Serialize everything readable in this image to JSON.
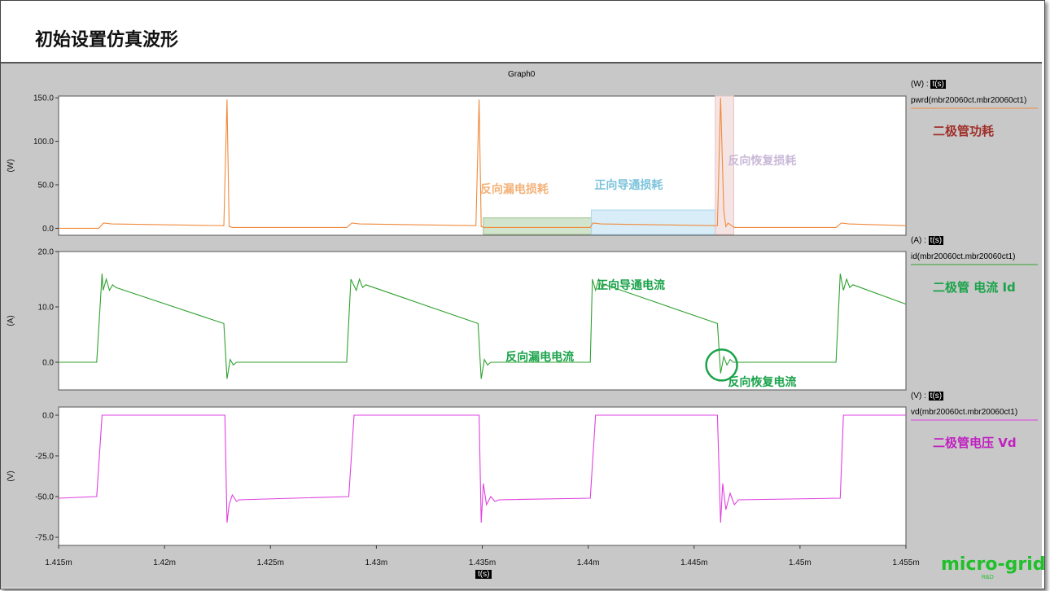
{
  "slide": {
    "title": "初始设置仿真波形"
  },
  "graph": {
    "name": "Graph0",
    "xlabel": "t(s)"
  },
  "chart_data": [
    {
      "type": "line",
      "ylabel": "(W)",
      "legend_unit": "(W) : t(s)",
      "legend_name": "pwrd(mbr20060ct.mbr20060ct1)",
      "series_title": "二极管功耗",
      "color": "#f08a3c",
      "title_color": "#a0302a",
      "xlim": [
        1.415,
        1.455
      ],
      "ylim": [
        -8,
        152
      ],
      "yticks": [
        150,
        100,
        50,
        0
      ],
      "ytick_labels": [
        "150.0",
        "100.0",
        "50.0",
        "0.0"
      ],
      "series": [
        {
          "x": [
            1.415,
            1.4169,
            1.41712,
            1.4175,
            1.4228,
            1.42295,
            1.42305,
            1.4232,
            1.4286,
            1.42885,
            1.4292,
            1.4347,
            1.43485,
            1.43495,
            1.4351,
            1.4401,
            1.44022,
            1.4406,
            1.4461,
            1.44625,
            1.4464,
            1.4465,
            1.4466,
            1.4469,
            1.4517,
            1.45195,
            1.4523,
            1.455
          ],
          "y": [
            0,
            0,
            6,
            5,
            3,
            148,
            2,
            1,
            1,
            6,
            5,
            3,
            148,
            2,
            1,
            1,
            6,
            5,
            3,
            150,
            20,
            2,
            6,
            1,
            1,
            6,
            5,
            3
          ]
        }
      ],
      "annotations": [
        {
          "text": "反向漏电损耗",
          "color": "#f3b27a",
          "x": 1.4349,
          "y": 45
        },
        {
          "text": "正向导通损耗",
          "color": "#7cc3dc",
          "x": 1.4403,
          "y": 50
        },
        {
          "text": "反向恢复损耗",
          "color": "#c9b9d8",
          "x": 1.4466,
          "y": 78
        }
      ],
      "regions": [
        {
          "x0": 1.43505,
          "x1": 1.44015,
          "y0": -7,
          "y1": 12,
          "color": "#9dc38f"
        },
        {
          "x0": 1.44015,
          "x1": 1.446,
          "y0": -7,
          "y1": 21,
          "color": "#a8d8ee"
        },
        {
          "x0": 1.446,
          "x1": 1.44687,
          "y0": -7,
          "y1": 152,
          "color": "#e8c4c4"
        }
      ]
    },
    {
      "type": "line",
      "ylabel": "(A)",
      "legend_unit": "(A) : t(s)",
      "legend_name": "id(mbr20060ct.mbr20060ct1)",
      "series_title": "二极管 电流 Id",
      "color": "#2fa12f",
      "title_color": "#1aa34a",
      "xlim": [
        1.415,
        1.455
      ],
      "ylim": [
        -5,
        20
      ],
      "yticks": [
        20,
        10,
        0
      ],
      "ytick_labels": [
        "20.0",
        "10.0",
        "0.0"
      ],
      "series": [
        {
          "x": [
            1.415,
            1.4168,
            1.41705,
            1.4171,
            1.41725,
            1.4174,
            1.41755,
            1.4177,
            1.4228,
            1.42295,
            1.4231,
            1.42325,
            1.4234,
            1.4286,
            1.4288,
            1.42905,
            1.4292,
            1.42935,
            1.4295,
            1.4348,
            1.43495,
            1.4351,
            1.43525,
            1.4354,
            1.4401,
            1.4402,
            1.44035,
            1.4405,
            1.44065,
            1.4408,
            1.4461,
            1.44625,
            1.4464,
            1.44655,
            1.4467,
            1.44685,
            1.447,
            1.4517,
            1.4519,
            1.45205,
            1.4522,
            1.45235,
            1.4525,
            1.455
          ],
          "y": [
            0,
            0,
            16,
            13,
            15,
            13,
            14,
            13.5,
            7,
            -3,
            0.5,
            -0.5,
            0,
            0,
            15,
            13,
            15,
            13.5,
            14,
            7,
            -3,
            0.5,
            -0.5,
            0,
            0,
            15,
            13,
            15,
            13.5,
            14,
            7,
            -2,
            1,
            -0.5,
            0.5,
            0,
            0,
            0,
            16,
            13,
            15,
            13.5,
            14,
            10.5
          ]
        }
      ],
      "annotations": [
        {
          "text": "正向导通电流",
          "color": "#1aa34a",
          "x": 1.4404,
          "y": 14
        },
        {
          "text": "反向漏电电流",
          "color": "#1aa34a",
          "x": 1.4361,
          "y": 1
        },
        {
          "text": "反向恢复电流",
          "color": "#1aa34a",
          "x": 1.4466,
          "y": -3.5
        }
      ],
      "markers": [
        {
          "type": "circle",
          "x": 1.4463,
          "y": -0.5,
          "color": "#1aa34a"
        }
      ]
    },
    {
      "type": "line",
      "ylabel": "(V)",
      "legend_unit": "(V) : t(s)",
      "legend_name": "vd(mbr20060ct.mbr20060ct1)",
      "series_title": "二极管电压 Vd",
      "color": "#e040e0",
      "title_color": "#c020c0",
      "xlim": [
        1.415,
        1.455
      ],
      "ylim": [
        -80,
        5
      ],
      "yticks": [
        0,
        -25,
        -50,
        -75
      ],
      "ytick_labels": [
        "0.0",
        "-25.0",
        "-50.0",
        "-75.0"
      ],
      "series": [
        {
          "x": [
            1.415,
            1.4168,
            1.41705,
            1.42285,
            1.42295,
            1.42305,
            1.4232,
            1.4234,
            1.4235,
            1.4287,
            1.42895,
            1.43485,
            1.43495,
            1.43505,
            1.4352,
            1.4354,
            1.4356,
            1.4358,
            1.4401,
            1.44035,
            1.4461,
            1.44625,
            1.44635,
            1.4465,
            1.4467,
            1.4469,
            1.4471,
            1.4519,
            1.45205,
            1.455
          ],
          "y": [
            -51,
            -50,
            0,
            0,
            -66,
            -55,
            -49,
            -53,
            -52,
            -50,
            0,
            0,
            -66,
            -42,
            -55,
            -50,
            -53,
            -52,
            -51,
            0,
            0,
            -66,
            -42,
            -58,
            -48,
            -55,
            -52,
            -51,
            0,
            0
          ]
        }
      ]
    }
  ],
  "xaxis": {
    "ticks": [
      1.415,
      1.42,
      1.425,
      1.43,
      1.435,
      1.44,
      1.445,
      1.45,
      1.455
    ],
    "tick_labels": [
      "1.415m",
      "1.42m",
      "1.425m",
      "1.43m",
      "1.435m",
      "1.44m",
      "1.445m",
      "1.45m",
      "1.455m"
    ]
  },
  "brand": {
    "name": "micro-grid",
    "sub": "R&D"
  }
}
